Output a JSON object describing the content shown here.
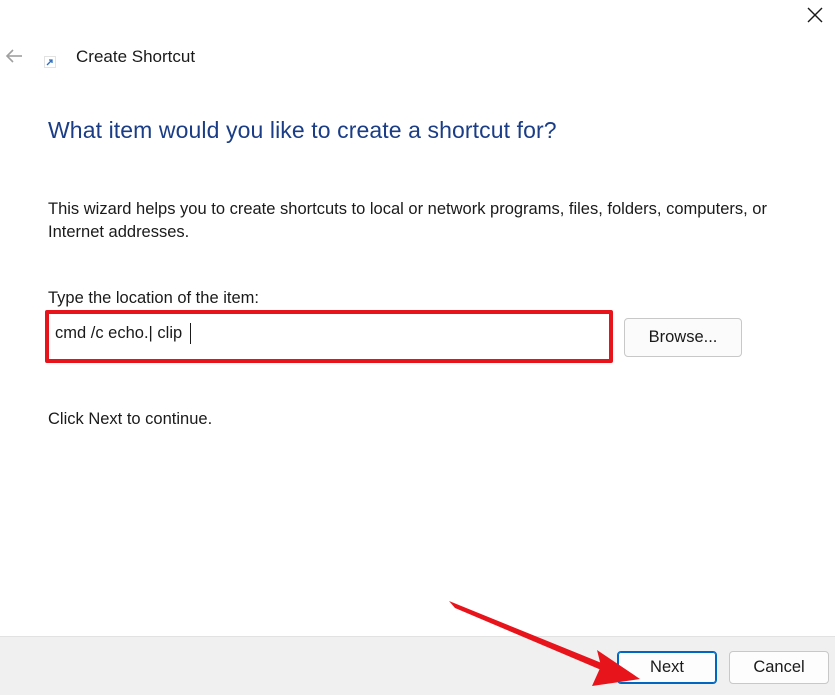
{
  "window": {
    "title": "Create Shortcut",
    "close_icon": "close-icon",
    "back_icon": "back-arrow-icon",
    "app_icon": "shortcut-icon"
  },
  "main": {
    "heading": "What item would you like to create a shortcut for?",
    "description": "This wizard helps you to create shortcuts to local or network programs, files, folders, computers, or Internet addresses.",
    "location_label": "Type the location of the item:",
    "location_value": "cmd /c echo.| clip",
    "browse_label": "Browse...",
    "continue_text": "Click Next to continue."
  },
  "footer": {
    "next_label": "Next",
    "cancel_label": "Cancel"
  },
  "annotations": {
    "highlight_color": "#e8141c",
    "arrow_color": "#e8141c",
    "arrow_target": "next-button"
  },
  "colors": {
    "heading": "#1a3d86",
    "accent": "#0067c0",
    "footer_bg": "#f0f0f0"
  }
}
